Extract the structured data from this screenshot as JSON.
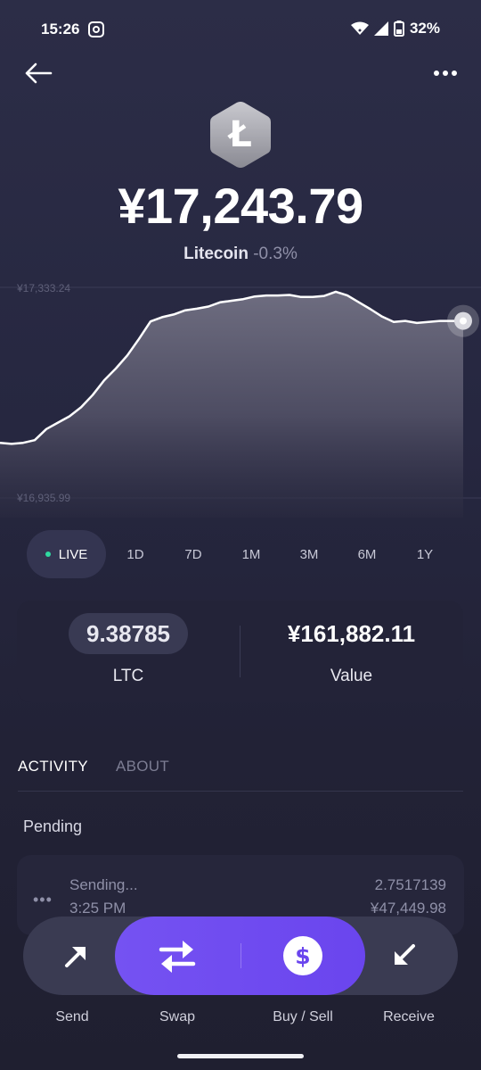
{
  "status_bar": {
    "time": "15:26",
    "battery": "32%"
  },
  "coin": {
    "price": "¥17,243.79",
    "name": "Litecoin",
    "change": "-0.3%",
    "symbol_glyph": "Ł"
  },
  "chart": {
    "y_max_label": "¥17,333.24",
    "y_min_label": "¥16,935.99"
  },
  "chart_data": {
    "type": "area",
    "ylim": [
      16935.99,
      17333.24
    ],
    "x": [
      0,
      1,
      2,
      3,
      4,
      5,
      6,
      7,
      8,
      9,
      10,
      11,
      12,
      13,
      14,
      15,
      16,
      17,
      18,
      19,
      20,
      21,
      22,
      23,
      24,
      25,
      26,
      27,
      28,
      29,
      30,
      31,
      32,
      33,
      34,
      35,
      36,
      37,
      38,
      39,
      40
    ],
    "values": [
      17040,
      17038,
      17040,
      17045,
      17066,
      17078,
      17090,
      17107,
      17130,
      17158,
      17180,
      17205,
      17236,
      17269,
      17277,
      17282,
      17290,
      17293,
      17297,
      17305,
      17308,
      17311,
      17316,
      17318,
      17318,
      17319,
      17315,
      17315,
      17317,
      17325,
      17318,
      17305,
      17292,
      17278,
      17268,
      17270,
      17266,
      17268,
      17270,
      17270,
      17270
    ],
    "grid": true
  },
  "ranges": [
    {
      "label": "LIVE",
      "active": true
    },
    {
      "label": "1D",
      "active": false
    },
    {
      "label": "7D",
      "active": false
    },
    {
      "label": "1M",
      "active": false
    },
    {
      "label": "3M",
      "active": false
    },
    {
      "label": "6M",
      "active": false
    },
    {
      "label": "1Y",
      "active": false
    }
  ],
  "holdings": {
    "amount": "9.38785",
    "unit": "LTC",
    "value": "¥161,882.11",
    "value_label": "Value"
  },
  "tabs": {
    "activity": "ACTIVITY",
    "about": "ABOUT"
  },
  "pending": {
    "heading": "Pending",
    "status": "Sending...",
    "time": "3:25 PM",
    "amount": "2.7517139",
    "value": "¥47,449.98"
  },
  "actions": {
    "send": "Send",
    "swap": "Swap",
    "buy_sell": "Buy / Sell",
    "receive": "Receive"
  },
  "colors": {
    "accent": "#6a45ee",
    "live_dot": "#2fd9a0",
    "background": "#262740"
  }
}
